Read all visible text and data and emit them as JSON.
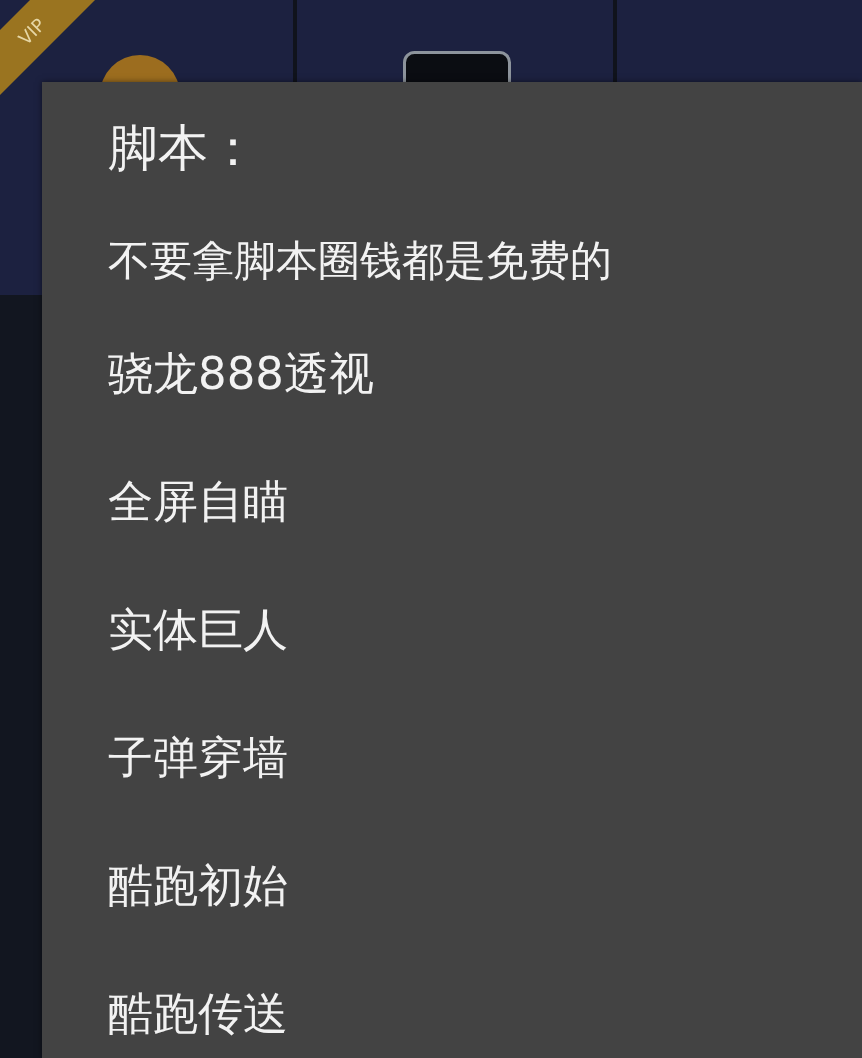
{
  "ribbon": {
    "label": "VIP"
  },
  "dialog": {
    "title": "脚本：",
    "message": "不要拿脚本圈钱都是免费的",
    "items": [
      "骁龙888透视",
      "全屏自瞄",
      "实体巨人",
      "子弹穿墙",
      "酷跑初始",
      "酷跑传送"
    ]
  }
}
